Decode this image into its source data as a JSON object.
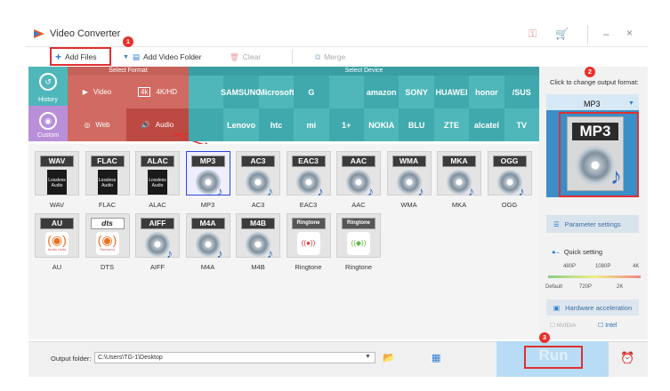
{
  "window": {
    "title": "Video Converter"
  },
  "toolbar": {
    "add_files": "Add Files",
    "add_video_folder": "Add Video Folder",
    "clear": "Clear",
    "merge": "Merge"
  },
  "badges": {
    "one": "1",
    "two": "2",
    "three": "3"
  },
  "sidebar": {
    "history": "History",
    "custom": "Custom"
  },
  "headers": {
    "select_format": "Select Format",
    "select_device": "Select Device"
  },
  "format_tabs": {
    "video": "Video",
    "hd": "4K/HD",
    "web": "Web",
    "audio": "Audio"
  },
  "devices_row1": [
    "",
    "SAMSUNG",
    "Microsoft",
    "G",
    "",
    "amazon",
    "SONY",
    "HUAWEI",
    "honor",
    "/SUS"
  ],
  "devices_row2": [
    "",
    "Lenovo",
    "htc",
    "mi",
    "1+",
    "NOKIA",
    "BLU",
    "ZTE",
    "alcatel",
    "TV"
  ],
  "formats_row1": [
    {
      "label": "WAV",
      "name": "WAV",
      "sub": "Lossless Audio"
    },
    {
      "label": "FLAC",
      "name": "FLAC",
      "sub": "Lossless Audio"
    },
    {
      "label": "ALAC",
      "name": "ALAC",
      "sub": "Lossless Audio"
    },
    {
      "label": "MP3",
      "name": "MP3"
    },
    {
      "label": "AC3",
      "name": "AC3"
    },
    {
      "label": "EAC3",
      "name": "EAC3"
    },
    {
      "label": "AAC",
      "name": "AAC"
    },
    {
      "label": "WMA",
      "name": "WMA"
    },
    {
      "label": "MKA",
      "name": "MKA"
    },
    {
      "label": "OGG",
      "name": "OGG"
    }
  ],
  "formats_row2": [
    {
      "label": "AU",
      "name": "AU",
      "sub": "Audio Units"
    },
    {
      "label": "dts",
      "name": "DTS",
      "sub": "Surround"
    },
    {
      "label": "AIFF",
      "name": "AIFF"
    },
    {
      "label": "M4A",
      "name": "M4A"
    },
    {
      "label": "M4B",
      "name": "M4B"
    },
    {
      "label": "Ringtone",
      "name": "Ringtone"
    },
    {
      "label": "Ringtone",
      "name": "Ringtone"
    }
  ],
  "right_panel": {
    "hint": "Click to change output format:",
    "selected_format": "MP3",
    "preview_label": "MP3",
    "parameter_settings": "Parameter settings",
    "quick_setting": "Quick setting",
    "q_top": [
      "480P",
      "1080P",
      "4K"
    ],
    "q_bottom": [
      "Default",
      "720P",
      "2K"
    ],
    "hardware_acceleration": "Hardware acceleration",
    "nvidia": "NVIDIA",
    "intel": "Intel"
  },
  "bottom": {
    "output_folder_label": "Output folder:",
    "output_path": "C:\\Users\\TG-1\\Desktop",
    "run": "Run"
  },
  "colors": {
    "accent_red": "#e03030",
    "teal": "#3a9ea3",
    "format_red": "#d06a62",
    "run_blue": "#b8dcf5"
  }
}
